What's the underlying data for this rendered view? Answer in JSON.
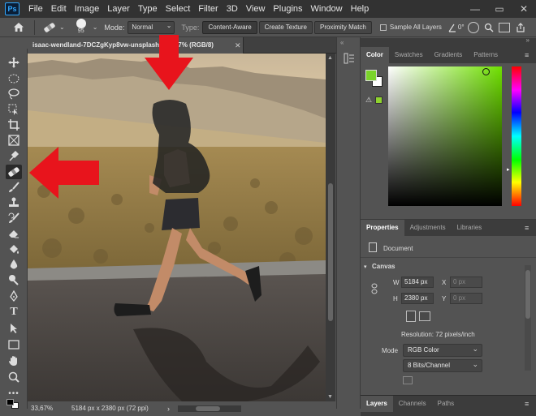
{
  "menubar": {
    "logo": "Ps",
    "items": [
      "File",
      "Edit",
      "Image",
      "Layer",
      "Type",
      "Select",
      "Filter",
      "3D",
      "View",
      "Plugins",
      "Window",
      "Help"
    ]
  },
  "options": {
    "brush_size": "95",
    "mode_label": "Mode:",
    "mode_value": "Normal",
    "type_label": "Type:",
    "type_buttons": [
      "Content-Aware",
      "Create Texture",
      "Proximity Match"
    ],
    "sample_all_layers": "Sample All Layers",
    "angle_value": "0°"
  },
  "document": {
    "tab_title": "isaac-wendland-7DCZgKyp8vw-unsplash @ 33,7% (RGB/8)",
    "status_zoom": "33,67%",
    "status_info": "5184 px x 2380 px (72 ppi)"
  },
  "color_panel": {
    "tabs": [
      "Color",
      "Swatches",
      "Gradients",
      "Patterns"
    ],
    "foreground": "#7ad42a",
    "background": "#ffffff",
    "gamut_swatch": "#8fd32e",
    "hue_color": "#6fe000"
  },
  "properties_panel": {
    "tabs": [
      "Properties",
      "Adjustments",
      "Libraries"
    ],
    "doc_label": "Document",
    "section_canvas": "Canvas",
    "w_label": "W",
    "w_value": "5184 px",
    "h_label": "H",
    "h_value": "2380 px",
    "x_label": "X",
    "x_value": "0 px",
    "y_label": "Y",
    "y_value": "0 px",
    "resolution": "Resolution: 72 pixels/inch",
    "mode_label": "Mode",
    "mode_value": "RGB Color",
    "bits_value": "8 Bits/Channel"
  },
  "layers_panel": {
    "tabs": [
      "Layers",
      "Channels",
      "Paths"
    ]
  },
  "annotation_color": "#e8141c"
}
